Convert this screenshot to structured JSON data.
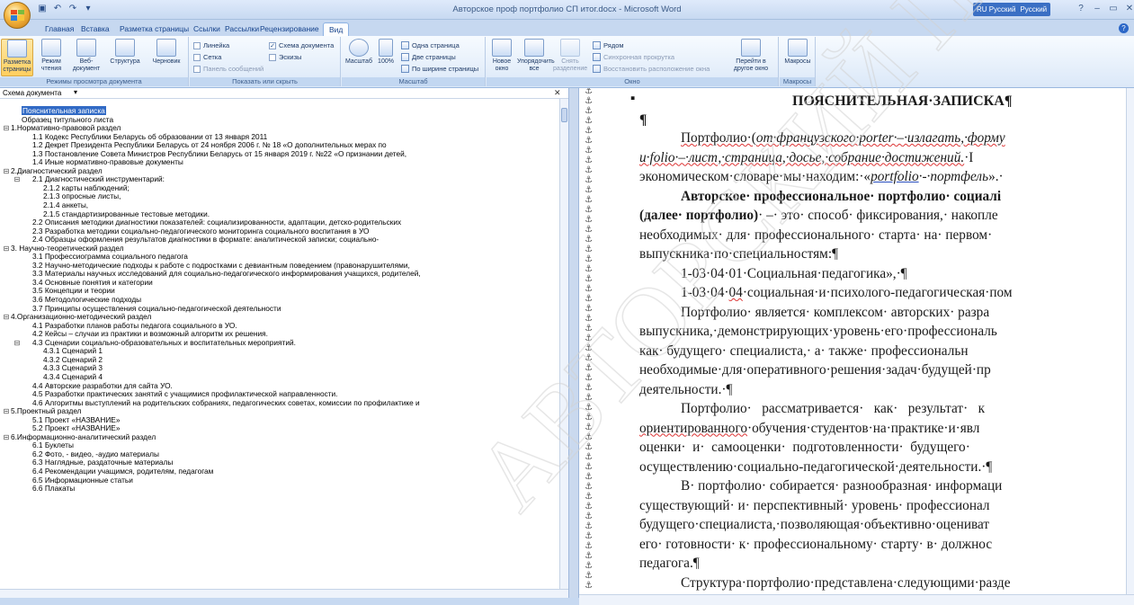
{
  "window": {
    "title": "Авторское проф портфолио СП итог.docx - Microsoft Word",
    "language_indicator": "RU Русский",
    "keyboard_language": "Русский"
  },
  "tabs": [
    "Главная",
    "Вставка",
    "Разметка страницы",
    "Ссылки",
    "Рассылки",
    "Рецензирование",
    "Вид"
  ],
  "active_tab": "Вид",
  "ribbon": {
    "doc_views": {
      "label": "Режимы просмотра документа",
      "buttons": [
        "Разметка страницы",
        "Режим чтения",
        "Веб-документ",
        "Структура",
        "Черновик"
      ]
    },
    "show_hide": {
      "label": "Показать или скрыть",
      "items": [
        {
          "label": "Линейка",
          "checked": false
        },
        {
          "label": "Схема документа",
          "checked": true
        },
        {
          "label": "Сетка",
          "checked": false
        },
        {
          "label": "Эскизы",
          "checked": false
        },
        {
          "label": "Панель сообщений",
          "checked": false,
          "disabled": true
        }
      ]
    },
    "zoom": {
      "label": "Масштаб",
      "buttons": [
        "Масштаб",
        "100%"
      ],
      "options": [
        "Одна страница",
        "Две страницы",
        "По ширине страницы"
      ]
    },
    "window_group": {
      "label": "Окно",
      "buttons": [
        "Новое окно",
        "Упорядочить все",
        "Снять разделение"
      ],
      "options": [
        "Рядом",
        "Синхронная прокрутка",
        "Восстановить расположение окна"
      ],
      "switch": "Перейти в другое окно"
    },
    "macros": {
      "label": "Макросы",
      "button": "Макросы"
    }
  },
  "doc_map": {
    "title": "Схема документа"
  },
  "tree": [
    {
      "t": "Пояснительная записка",
      "l": 0,
      "sel": true
    },
    {
      "t": "Образец титульного листа",
      "l": 0
    },
    {
      "t": "1.Нормативно-правовой раздел",
      "l": 0,
      "tog": "⊟"
    },
    {
      "t": "1.1 Кодекс Республики Беларусь об образовании от 13 января 2011",
      "l": 1
    },
    {
      "t": "1.2 Декрет Президента Республики Беларусь от 24 ноября 2006 г. № 18 «О дополнительных мерах по",
      "l": 1
    },
    {
      "t": "1.3 Постановление Совета Министров Республики Беларусь от 15 января 2019 г. №22 «О признании детей,",
      "l": 1
    },
    {
      "t": "1.4 Иные нормативно-правовые документы",
      "l": 1
    },
    {
      "t": "2.Диагностический раздел",
      "l": 0,
      "tog": "⊟"
    },
    {
      "t": "2.1 Диагностический инструментарий:",
      "l": 1,
      "tog": "⊟"
    },
    {
      "t": "2.1.2 карты наблюдений;",
      "l": 2
    },
    {
      "t": "2.1.3 опросные листы,",
      "l": 2
    },
    {
      "t": "2.1.4 анкеты,",
      "l": 2
    },
    {
      "t": "2.1.5 стандартизированные тестовые методики.",
      "l": 2
    },
    {
      "t": "2.2 Описания методики диагностики показателей: социализированности, адаптации, детско-родительских",
      "l": 1
    },
    {
      "t": "2.3 Разработка методики социально-педагогического мониторинга социального воспитания в УО",
      "l": 1
    },
    {
      "t": "2.4 Образцы оформления результатов диагностики в формате: аналитической записки; социально-",
      "l": 1
    },
    {
      "t": "3. Научно-теоретический раздел",
      "l": 0,
      "tog": "⊟"
    },
    {
      "t": "3.1 Профессиограмма социального педагога",
      "l": 1
    },
    {
      "t": "3.2 Научно-методические подходы к работе с подростками с девиантным поведением (правонарушителями,",
      "l": 1
    },
    {
      "t": "3.3 Материалы научных исследований для социально-педагогического информирования учащихся, родителей,",
      "l": 1
    },
    {
      "t": "3.4 Основные понятия и категории",
      "l": 1
    },
    {
      "t": "3.5 Концепции и теории",
      "l": 1
    },
    {
      "t": "3.6 Методологические подходы",
      "l": 1
    },
    {
      "t": "3.7 Принципы осуществления социально-педагогической деятельности",
      "l": 1
    },
    {
      "t": "4.Организационно-методический раздел",
      "l": 0,
      "tog": "⊟"
    },
    {
      "t": "4.1 Разработки планов работы педагога социального в УО.",
      "l": 1
    },
    {
      "t": "4.2 Кейсы – случаи из практики и возможный алгоритм их решения.",
      "l": 1
    },
    {
      "t": "4.3 Сценарии социально-образовательных и воспитательных мероприятий.",
      "l": 1,
      "tog": "⊟"
    },
    {
      "t": "4.3.1 Сценарий 1",
      "l": 2
    },
    {
      "t": "4.3.2 Сценарий 2",
      "l": 2
    },
    {
      "t": "4.3.3 Сценарий 3",
      "l": 2
    },
    {
      "t": "4.3.4 Сценарий 4",
      "l": 2
    },
    {
      "t": "4.4 Авторские разработки для сайта УО.",
      "l": 1
    },
    {
      "t": "4.5 Разработки практических занятий с учащимися профилактической направленности.",
      "l": 1
    },
    {
      "t": "4.6 Алгоритмы выступлений на родительских собраниях, педагогических советах, комиссии по профилактике и",
      "l": 1
    },
    {
      "t": "5.Проектный раздел",
      "l": 0,
      "tog": "⊟"
    },
    {
      "t": "5.1 Проект «НАЗВАНИЕ»",
      "l": 1
    },
    {
      "t": "5.2 Проект «НАЗВАНИЕ»",
      "l": 1
    },
    {
      "t": "6.Информационно-аналитический раздел",
      "l": 0,
      "tog": "⊟"
    },
    {
      "t": "6.1 Буклеты",
      "l": 1
    },
    {
      "t": "6.2 Фото, - видео, -аудио материалы",
      "l": 1
    },
    {
      "t": "6.3 Наглядные, раздаточные материалы",
      "l": 1
    },
    {
      "t": "6.4 Рекомендации учащимся, родителям, педагогам",
      "l": 1
    },
    {
      "t": "6.5 Информационные статьи",
      "l": 1
    },
    {
      "t": "6.6 Плакаты",
      "l": 1
    }
  ],
  "document": {
    "heading": "ПОЯСНИТЕЛЬНАЯ·ЗАПИСКА¶",
    "pilcrow": "¶",
    "lines": [
      {
        "x": 46,
        "html": "<span class='ul-red'>Портфолио·(<i>от·французского·porter·–·излагать,·форму</i></span>"
      },
      {
        "x": 0,
        "html": "<span class='ul-red'><i>и·folio·–·лист,·страница,·досье,·собрание·достижений.</i></span>·I"
      },
      {
        "x": 0,
        "html": "экономическом·словаре·мы·находим:·«<i><span class='ul-blue'>portfolio</span>·-·портфель</i>».·"
      },
      {
        "x": 46,
        "html": "<b>Авторское·&nbsp;профессиональное·&nbsp;портфолио·&nbsp;социалі</b>"
      },
      {
        "x": 0,
        "html": "<b>(далее·&nbsp;портфолио)</b>·&nbsp;–·&nbsp;это·&nbsp;способ·&nbsp;фиксирования,·&nbsp;накопле"
      },
      {
        "x": 0,
        "html": "необходимых·&nbsp;для·&nbsp;профессионального·&nbsp;старта·&nbsp;на·&nbsp;первом·"
      },
      {
        "x": 0,
        "html": "выпускника·по·специальностям:¶"
      },
      {
        "x": 46,
        "html": "1-03·04·01·Социальная·педагогика»,·¶"
      },
      {
        "x": 46,
        "html": "1-03·04·<span class='ul-red'>04</span>·социальная·и·психолого-педагогическая·пом"
      },
      {
        "x": 46,
        "html": "Портфолио·&nbsp;является·&nbsp;комплексом·&nbsp;авторских·&nbsp;разра"
      },
      {
        "x": 0,
        "html": "выпускника,·демонстрирующих·уровень·его·профессиональ"
      },
      {
        "x": 0,
        "html": "как·&nbsp;будущего·&nbsp;специалиста,·&nbsp;а·&nbsp;также·&nbsp;профессиональн"
      },
      {
        "x": 0,
        "html": "необходимые·для·оперативного·решения·задач·будущей·пр"
      },
      {
        "x": 0,
        "html": "деятельности.·¶"
      },
      {
        "x": 46,
        "html": "Портфолио·&nbsp;&nbsp;&nbsp;рассматривается·&nbsp;&nbsp;&nbsp;как·&nbsp;&nbsp;&nbsp;результат·&nbsp;&nbsp;&nbsp;к"
      },
      {
        "x": 0,
        "html": "<span class='ul-red'>ориентированного</span>·обучения·студентов·на·практике·и·явл"
      },
      {
        "x": 0,
        "html": "оценки·&nbsp;&nbsp;и·&nbsp;&nbsp;самооценки·&nbsp;&nbsp;подготовленности·&nbsp;&nbsp;будущего·&nbsp;"
      },
      {
        "x": 0,
        "html": "осуществлению·социально-педагогической·деятельности.·¶"
      },
      {
        "x": 46,
        "html": "В·&nbsp;портфолио·&nbsp;собирается·&nbsp;разнообразная·&nbsp;информаци"
      },
      {
        "x": 0,
        "html": "существующий·&nbsp;и·&nbsp;перспективный·&nbsp;уровень·&nbsp;профессионал"
      },
      {
        "x": 0,
        "html": "будущего·специалиста,·позволяющая·объективно·оцениват"
      },
      {
        "x": 0,
        "html": "его·&nbsp;готовности·&nbsp;к·&nbsp;профессиональному·&nbsp;старту·&nbsp;в·&nbsp;должнос"
      },
      {
        "x": 0,
        "html": "педагога.¶"
      },
      {
        "x": 46,
        "html": "Структура·портфолио·представлена·следующими·разде"
      }
    ]
  },
  "watermark": "АВТОРСКИЙ ПОРТФОЛИО"
}
